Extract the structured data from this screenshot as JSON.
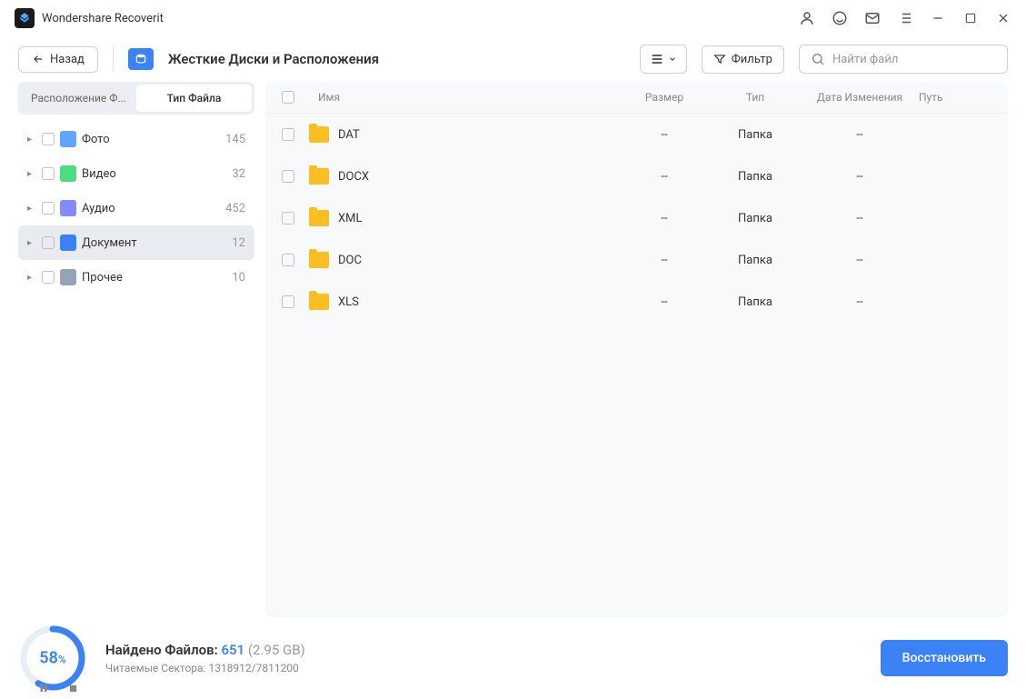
{
  "app": {
    "title": "Wondershare Recoverit"
  },
  "toolbar": {
    "back": "Назад",
    "breadcrumb": "Жесткие Диски и Расположения",
    "filter": "Фильтр",
    "search_placeholder": "Найти файл"
  },
  "sidebar": {
    "tabs": {
      "location": "Расположение Ф...",
      "filetype": "Тип Файла"
    },
    "items": [
      {
        "label": "Фото",
        "count": "145",
        "icon": "photo"
      },
      {
        "label": "Видео",
        "count": "32",
        "icon": "video"
      },
      {
        "label": "Аудио",
        "count": "452",
        "icon": "audio"
      },
      {
        "label": "Документ",
        "count": "12",
        "icon": "doc",
        "selected": true
      },
      {
        "label": "Прочее",
        "count": "10",
        "icon": "other"
      }
    ]
  },
  "table": {
    "headers": {
      "name": "Имя",
      "size": "Размер",
      "type": "Тип",
      "date": "Дата Изменения",
      "path": "Путь"
    },
    "rows": [
      {
        "name": "DAT",
        "size": "--",
        "type": "Папка",
        "date": "--",
        "path": ""
      },
      {
        "name": "DOCX",
        "size": "--",
        "type": "Папка",
        "date": "--",
        "path": ""
      },
      {
        "name": "XML",
        "size": "--",
        "type": "Папка",
        "date": "--",
        "path": ""
      },
      {
        "name": "DOC",
        "size": "--",
        "type": "Папка",
        "date": "--",
        "path": ""
      },
      {
        "name": "XLS",
        "size": "--",
        "type": "Папка",
        "date": "--",
        "path": ""
      }
    ]
  },
  "footer": {
    "progress_percent": "58",
    "progress_unit": "%",
    "found_label": "Найдено Файлов:",
    "found_count": "651",
    "found_size": "(2.95 GB)",
    "sectors_label": "Читаемые Сектора:",
    "sectors_value": "1318912/7811200",
    "recover": "Восстановить"
  },
  "colors": {
    "accent": "#3b82f6"
  }
}
